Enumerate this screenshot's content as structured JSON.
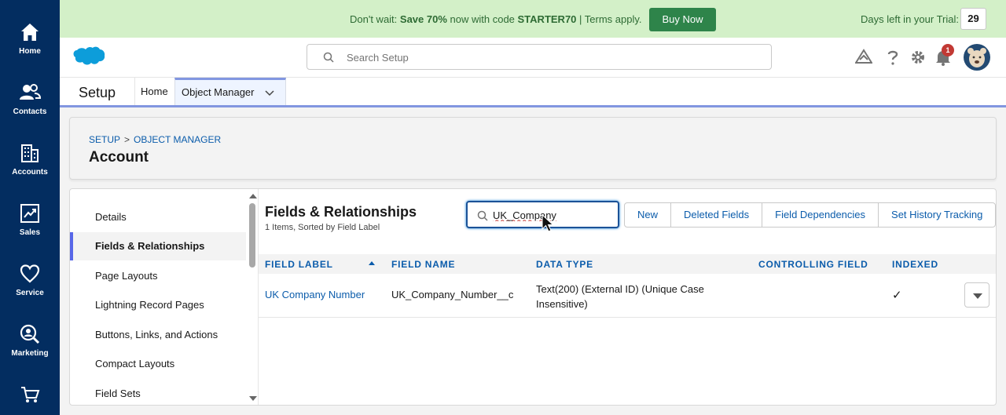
{
  "rail": {
    "items": [
      {
        "label": "Home"
      },
      {
        "label": "Contacts"
      },
      {
        "label": "Accounts"
      },
      {
        "label": "Sales"
      },
      {
        "label": "Service"
      },
      {
        "label": "Marketing"
      }
    ]
  },
  "promo": {
    "prefix": "Don't wait: ",
    "bold1": "Save 70%",
    "middle": " now with code ",
    "bold2": "STARTER70",
    "suffix": " | Terms apply.",
    "buy_label": "Buy Now",
    "trial_label": "Days left in your Trial:",
    "trial_days": "29"
  },
  "header": {
    "search_placeholder": "Search Setup",
    "notification_count": "1"
  },
  "context": {
    "app_name": "Setup",
    "tabs": [
      {
        "label": "Home"
      },
      {
        "label": "Object Manager"
      }
    ]
  },
  "page": {
    "breadcrumb": [
      "SETUP",
      "OBJECT MANAGER"
    ],
    "breadcrumb_sep": ">",
    "title": "Account"
  },
  "nav": {
    "items": [
      {
        "label": "Details"
      },
      {
        "label": "Fields & Relationships"
      },
      {
        "label": "Page Layouts"
      },
      {
        "label": "Lightning Record Pages"
      },
      {
        "label": "Buttons, Links, and Actions"
      },
      {
        "label": "Compact Layouts"
      },
      {
        "label": "Field Sets"
      }
    ],
    "active_index": 1
  },
  "section": {
    "title": "Fields & Relationships",
    "subtitle": "1 Items, Sorted by Field Label",
    "quick_find_value": "UK_Company",
    "buttons": [
      "New",
      "Deleted Fields",
      "Field Dependencies",
      "Set History Tracking"
    ]
  },
  "table": {
    "columns": [
      "FIELD LABEL",
      "FIELD NAME",
      "DATA TYPE",
      "CONTROLLING FIELD",
      "INDEXED"
    ],
    "rows": [
      {
        "field_label": "UK Company Number",
        "field_name": "UK_Company_Number__c",
        "data_type_line1": "Text(200) (External ID) (Unique Case",
        "data_type_line2": "Insensitive)",
        "controlling_field": "",
        "indexed": "✓"
      }
    ]
  },
  "colors": {
    "rail_bg": "#032d60",
    "promo_bg": "#d3f0c8",
    "buy_button": "#2e844a",
    "link": "#0b5cab",
    "accent": "#5867e8"
  }
}
